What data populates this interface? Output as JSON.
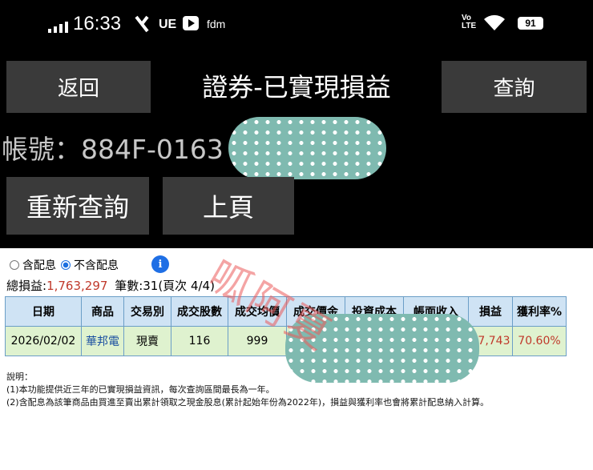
{
  "status_bar": {
    "time": "16:33",
    "ue_label": "UE",
    "fdm_label": "fdm",
    "lte_label": "Vo\nLTE",
    "battery": "91"
  },
  "header": {
    "back_label": "返回",
    "title": "證券-已實現損益",
    "query_label": "查詢"
  },
  "account": {
    "label": "帳號：884F-0163"
  },
  "actions": {
    "requery_label": "重新查詢",
    "prev_page_label": "上頁"
  },
  "options": {
    "with_dividend_label": "含配息",
    "without_dividend_label": "不含配息",
    "selected": "不含配息",
    "info_icon": "i"
  },
  "summary": {
    "total_label": "總損益:",
    "total_value": "1,763,297",
    "count_label": "筆數:31(頁次 4/4)"
  },
  "table": {
    "headers": [
      "日期",
      "商品",
      "交易別",
      "成交股數",
      "成交均價",
      "成交價金",
      "投資成本",
      "帳面收入",
      "損益",
      "獲利率%"
    ],
    "rows": [
      {
        "date": "2026/02/02",
        "product": "華邦電",
        "trade_type": "現賣",
        "shares": "116",
        "avg_price": "999",
        "amount": "",
        "cost": "",
        "income": "",
        "profit": "47,743",
        "rate": "70.60%"
      }
    ]
  },
  "notes": {
    "title": "說明：",
    "line1": "(1)本功能提供近三年的已實現損益資訊，每次查詢區間最長為一年。",
    "line2": "(2)含配息為該筆商品由買進至賣出累計領取之現金股息(累計起始年份為2022年)，損益與獲利率也會將累計配息納入計算。"
  },
  "watermark": {
    "text": "呱阿夏"
  },
  "colors": {
    "dark_bg": "#000000",
    "button_bg": "#3a3a3a",
    "link_blue": "#1a4fa0",
    "loss_red": "#c0392b",
    "table_header": "#cfe3f4",
    "table_row": "#dff2cf",
    "mask": "#7fbab0"
  }
}
